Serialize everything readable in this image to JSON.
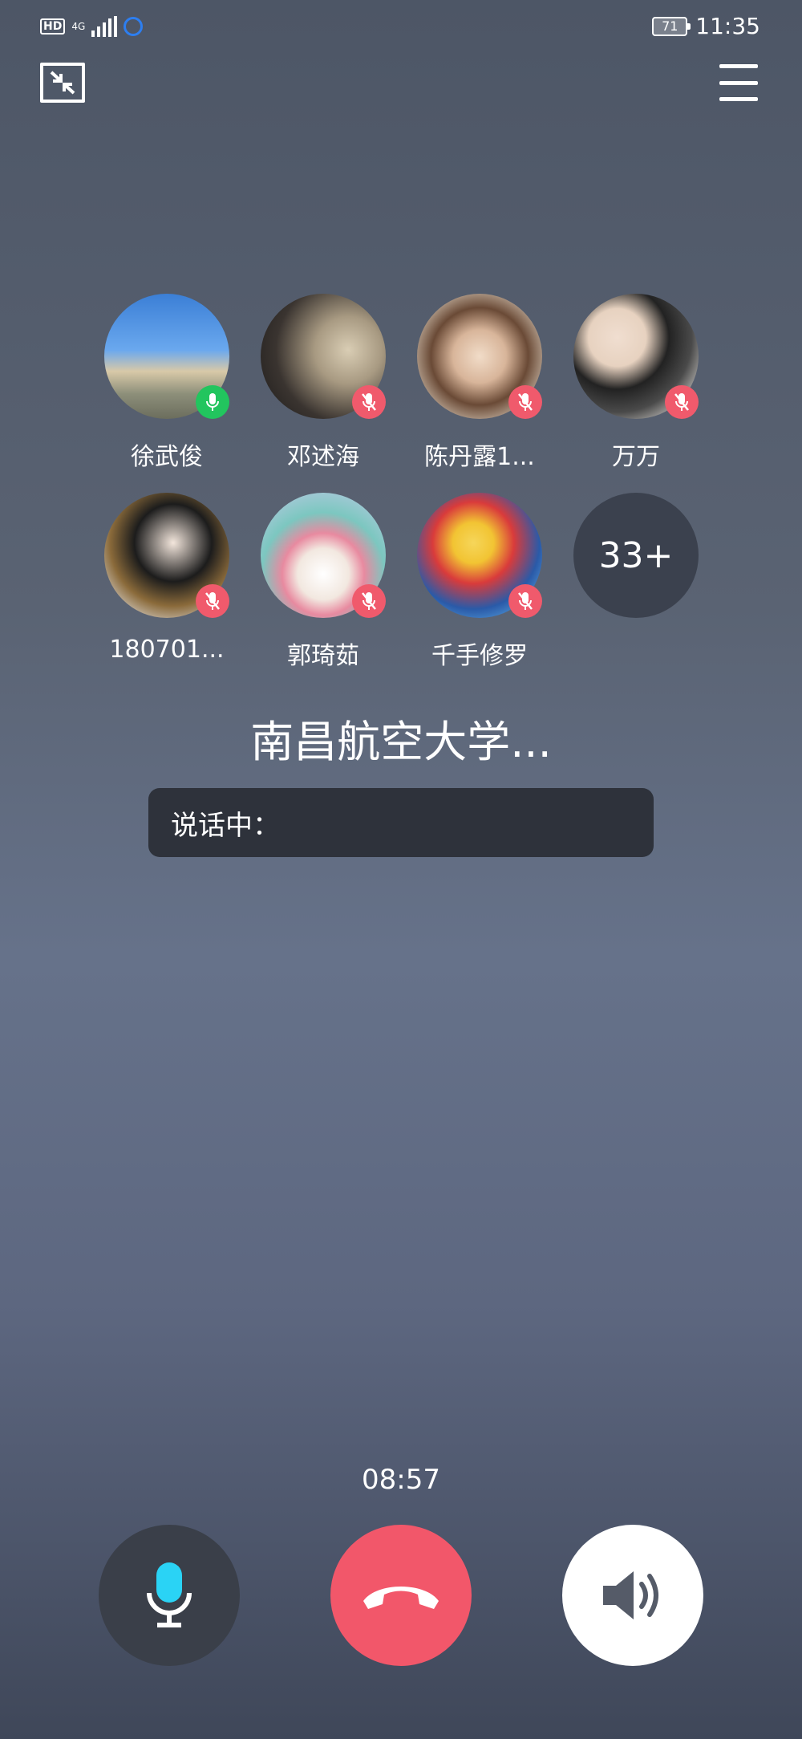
{
  "status_bar": {
    "hd": "HD",
    "network": "4G",
    "battery": "71",
    "time": "11:35"
  },
  "participants": [
    {
      "name": "徐武俊",
      "mic": "on"
    },
    {
      "name": "邓述海",
      "mic": "off"
    },
    {
      "name": "陈丹露1...",
      "mic": "off"
    },
    {
      "name": "万万",
      "mic": "off"
    },
    {
      "name": "180701...",
      "mic": "off"
    },
    {
      "name": "郭琦茹",
      "mic": "off"
    },
    {
      "name": "千手修罗",
      "mic": "off"
    }
  ],
  "more_count": "33+",
  "group_name": "南昌航空大学...",
  "speaking_label": "说话中：",
  "timer": "08:57",
  "colors": {
    "mic_on": "#22c55e",
    "mic_off": "#f05a6c",
    "hangup": "#f2576a",
    "mic_control_accent": "#2ad3f5"
  },
  "icons": {
    "minimize": "minimize-icon",
    "menu": "menu-icon",
    "mic": "microphone-icon",
    "hangup": "phone-hangup-icon",
    "speaker": "speaker-icon"
  }
}
